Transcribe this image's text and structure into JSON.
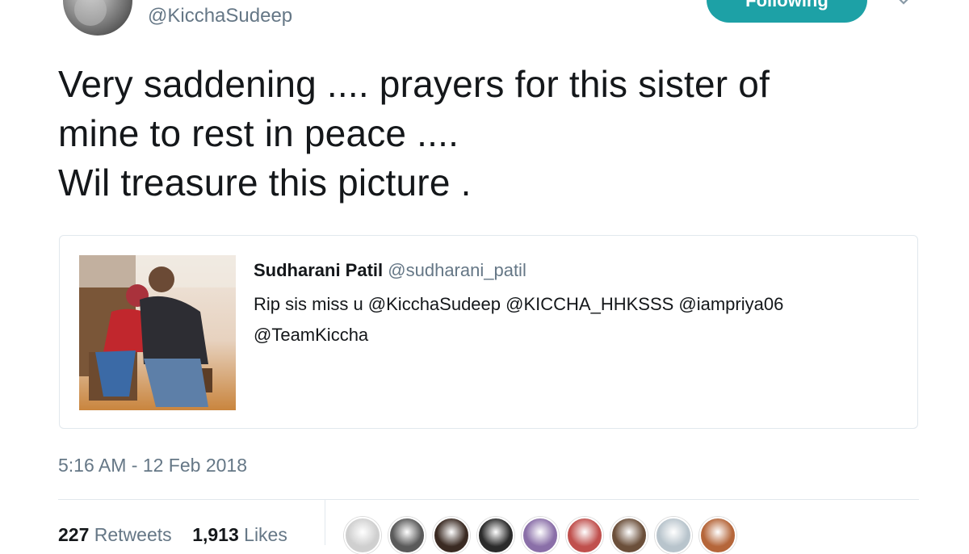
{
  "author": {
    "handle": "@KicchaSudeep",
    "follow_label": "Following"
  },
  "tweet": {
    "text": "Very saddening ....  prayers for this sister of\nmine to rest in peace ....\nWil treasure this picture .",
    "timestamp": "5:16 AM - 12 Feb 2018",
    "retweets_count": "227",
    "retweets_label": "Retweets",
    "likes_count": "1,913",
    "likes_label": "Likes"
  },
  "quoted_tweet": {
    "name": "Sudharani Patil",
    "handle": "@sudharani_patil",
    "text": "Rip sis miss u @KicchaSudeep @KICCHA_HHKSSS @iampriya06 @TeamKiccha"
  },
  "likers": [
    {
      "color": "#cfcfcf"
    },
    {
      "color": "#5a5a5a"
    },
    {
      "color": "#3a2a22"
    },
    {
      "color": "#2b2b2b"
    },
    {
      "color": "#8a6fa8"
    },
    {
      "color": "#c0504d"
    },
    {
      "color": "#6b4f3a"
    },
    {
      "color": "#b8c4cc"
    },
    {
      "color": "#b5663a"
    }
  ]
}
